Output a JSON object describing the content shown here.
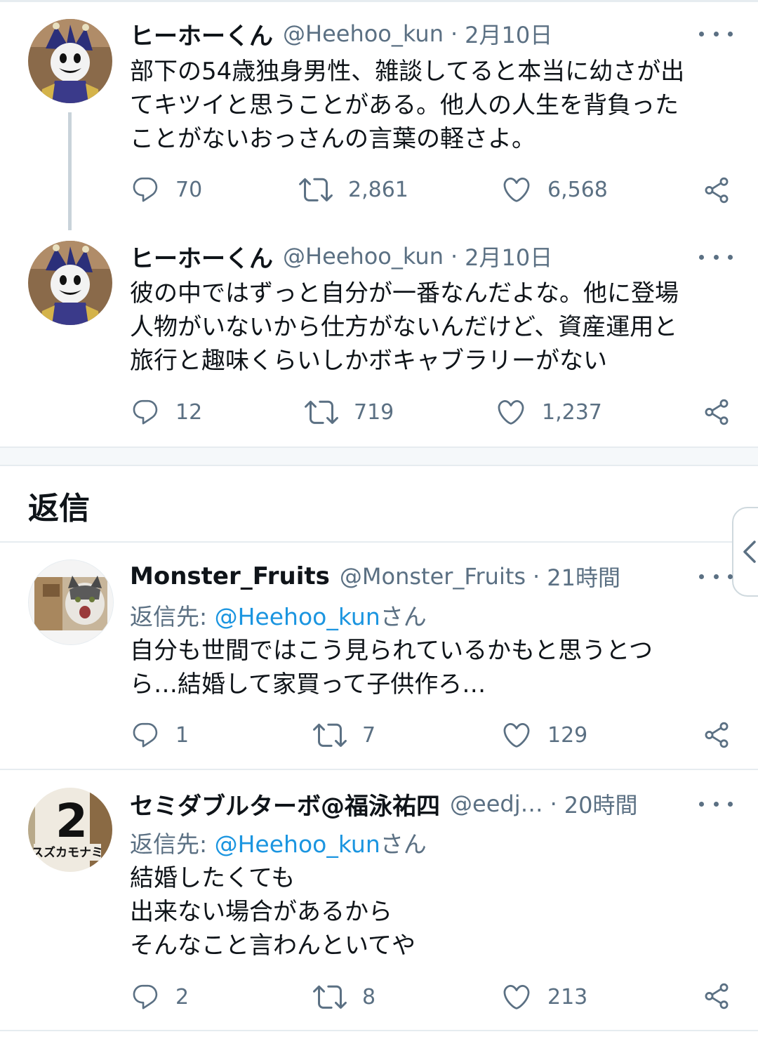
{
  "tweets": [
    {
      "name": "ヒーホーくん",
      "handle": "@Heehoo_kun",
      "time": "2月10日",
      "lines": [
        "部下の54歳独身男性、雑談してると本当に幼さが出",
        "てキツイと思うことがある。他人の人生を背負った",
        "ことがないおっさんの言葉の軽さよ。"
      ],
      "stats": {
        "replies": "70",
        "retweets": "2,861",
        "likes": "6,568"
      }
    },
    {
      "name": "ヒーホーくん",
      "handle": "@Heehoo_kun",
      "time": "2月10日",
      "lines": [
        "彼の中ではずっと自分が一番なんだよな。他に登場",
        "人物がいないから仕方がないんだけど、資産運用と",
        "旅行と趣味くらいしかボキャブラリーがない"
      ],
      "stats": {
        "replies": "12",
        "retweets": "719",
        "likes": "1,237"
      }
    }
  ],
  "replies_section": {
    "title": "返信"
  },
  "replies": [
    {
      "name": "Monster_Fruits",
      "handle": "@Monster_Fruits",
      "time": "21時間",
      "reply_prefix": "返信先: ",
      "reply_to": "@Heehoo_kun",
      "reply_suffix": "さん",
      "lines": [
        "自分も世間ではこう見られているかもと思うとつ",
        "ら…結婚して家買って子供作ろ…"
      ],
      "stats": {
        "replies": "1",
        "retweets": "7",
        "likes": "129"
      }
    },
    {
      "name": "セミダブルターボ@福泳祐四",
      "handle": "@eedj…",
      "time": "20時間",
      "reply_prefix": "返信先: ",
      "reply_to": "@Heehoo_kun",
      "reply_suffix": "さん",
      "lines": [
        "結婚したくても",
        "出来ない場合があるから",
        "そんなこと言わんといてや"
      ],
      "avatar_text": {
        "number": "2",
        "caption": "スズカモナミ"
      },
      "stats": {
        "replies": "2",
        "retweets": "8",
        "likes": "213"
      }
    }
  ],
  "icons": {
    "reply": "reply-icon",
    "retweet": "retweet-icon",
    "like": "heart-icon",
    "share": "share-icon",
    "more": "more-icon",
    "side_tab": "chevron-left-icon"
  },
  "colors": {
    "link": "#1b95e0",
    "secondary": "#5b7083",
    "text": "#0f1419",
    "divider": "#e6ecf0"
  }
}
